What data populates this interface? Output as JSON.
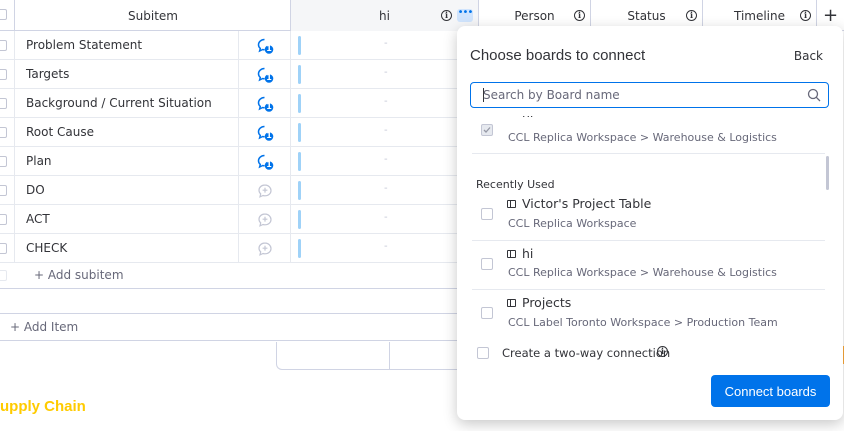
{
  "header": {
    "columns": {
      "subitem": "Subitem",
      "hi": "hi",
      "person": "Person",
      "status": "Status",
      "timeline": "Timeline"
    },
    "add_column": "+"
  },
  "subitems": [
    {
      "name": "Problem Statement",
      "updates": "1"
    },
    {
      "name": "Targets",
      "updates": "1"
    },
    {
      "name": "Background / Current Situation",
      "updates": "1"
    },
    {
      "name": "Root Cause",
      "updates": "1"
    },
    {
      "name": "Plan",
      "updates": "1"
    },
    {
      "name": "DO",
      "updates": ""
    },
    {
      "name": "ACT",
      "updates": ""
    },
    {
      "name": "CHECK",
      "updates": ""
    }
  ],
  "empty_cell": "-",
  "add_subitem": "+ Add subitem",
  "add_item": "+ Add Item",
  "group_title": "upply Chain",
  "dialog": {
    "title": "Choose boards to connect",
    "back": "Back",
    "search_placeholder": "Search by Board name",
    "selected_board": {
      "name": "hi",
      "path": "CCL Replica Workspace > Warehouse & Logistics",
      "checked": true
    },
    "recently_used_label": "Recently Used",
    "boards": [
      {
        "name": "Victor's Project Table",
        "path": "CCL Replica Workspace"
      },
      {
        "name": "hi",
        "path": "CCL Replica Workspace > Warehouse & Logistics"
      },
      {
        "name": "Projects",
        "path": "CCL Label Toronto Workspace > Production Team"
      }
    ],
    "two_way_label": "Create a two-way connection",
    "connect_button": "Connect boards"
  },
  "colors": {
    "primary": "#0073ea",
    "group_title": "#ffcb00",
    "status_orange": "#fdab3d",
    "hi_column_bar": "#9fd2f8"
  }
}
